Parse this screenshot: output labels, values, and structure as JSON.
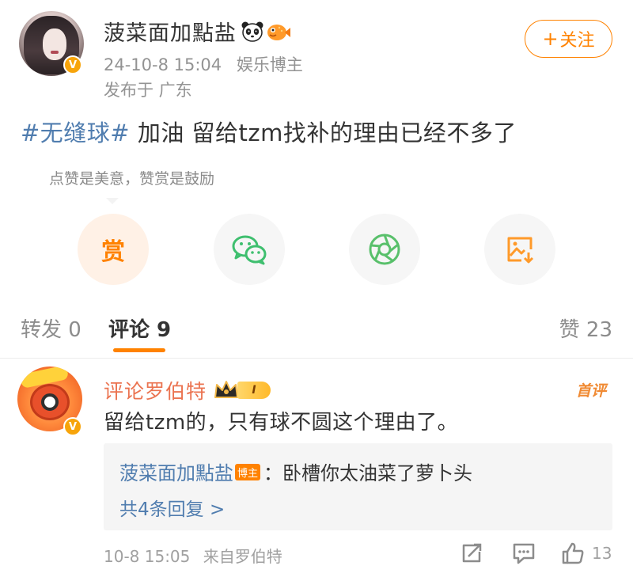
{
  "post": {
    "username": "菠菜面加點盐",
    "emojis": [
      "panda-emoji",
      "pufferfish-emoji"
    ],
    "verified": "V",
    "date": "24-10-8 15:04",
    "user_tag": "娱乐博主",
    "location": "发布于 广东",
    "follow_plus": "+",
    "follow_label": "关注",
    "hashtag": "#无缝球#",
    "text": " 加油 留给tzm找补的理由已经不多了"
  },
  "reward": {
    "tip": "点赞是美意，赞赏是鼓励",
    "reward_label": "赏",
    "buttons": [
      "reward-icon",
      "wechat-icon",
      "moments-icon",
      "save-image-icon"
    ]
  },
  "tabs": {
    "repost": "转发 0",
    "comments": "评论 9",
    "likes": "赞 23"
  },
  "comment": {
    "name": "评论罗伯特",
    "verified": "V",
    "level": "I",
    "hot_label": "首评",
    "text": "留给tzm的，只有球不圆这个理由了。",
    "reply": {
      "name": "菠菜面加點盐",
      "owner_tag": "博主",
      "text": "：卧槽你太油菜了萝卜头",
      "more": "共4条回复 >"
    },
    "time": "10-8 15:05",
    "source": "来自罗伯特",
    "like_count": "13"
  },
  "colors": {
    "accent": "#ff8200",
    "link": "#507daf",
    "comment_name": "#eb7350",
    "wechat": "#3fbf6f",
    "moments": "#59c06b"
  }
}
